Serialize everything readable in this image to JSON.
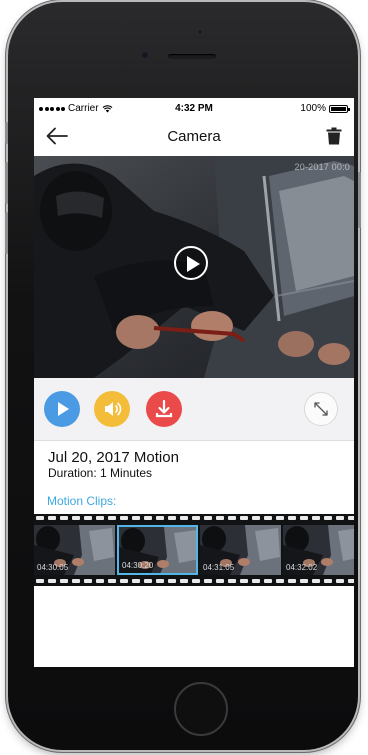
{
  "status_bar": {
    "carrier": "Carrier",
    "time": "4:32 PM",
    "battery": "100%"
  },
  "header": {
    "title": "Camera",
    "back_icon": "arrow-left-icon",
    "delete_icon": "trash-icon"
  },
  "video": {
    "timestamp_overlay": "20-2017 00:0"
  },
  "controls": {
    "play_icon": "play-icon",
    "sound_icon": "speaker-icon",
    "download_icon": "download-icon",
    "expand_icon": "expand-icon",
    "colors": {
      "play": "#4a9be4",
      "sound": "#f3bc39",
      "download": "#ea4a49"
    }
  },
  "event": {
    "title": "Jul 20, 2017 Motion",
    "duration": "Duration: 1 Minutes"
  },
  "clips": {
    "label": "Motion Clips:",
    "accent": "#3fa8de",
    "items": [
      {
        "time": "04:30:05",
        "selected": false
      },
      {
        "time": "04:30:20",
        "selected": true
      },
      {
        "time": "04:31:05",
        "selected": false
      },
      {
        "time": "04:32:02",
        "selected": false
      }
    ]
  }
}
